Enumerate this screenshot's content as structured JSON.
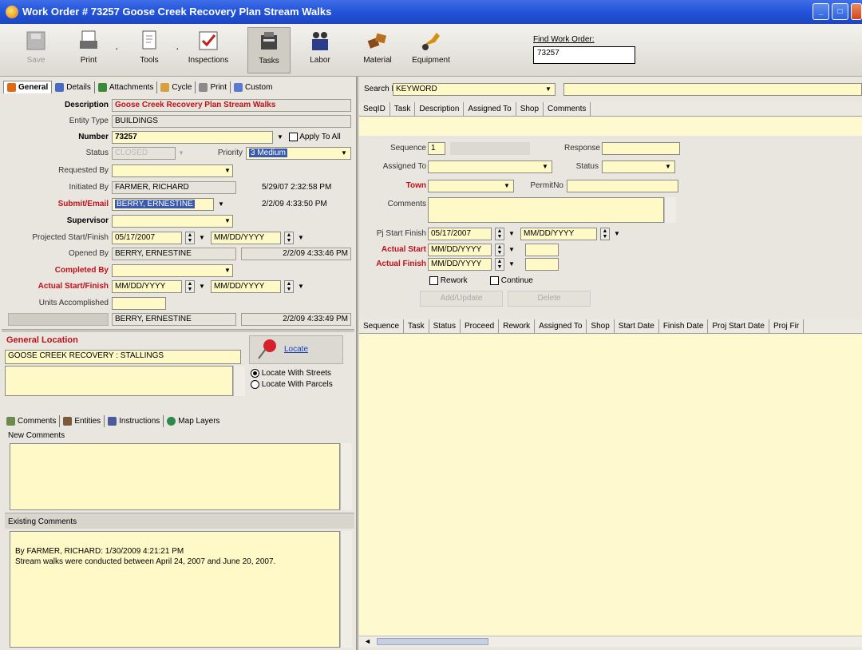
{
  "window": {
    "title": "Work Order # 73257  Goose Creek Recovery Plan Stream Walks"
  },
  "toolbar": {
    "save": "Save",
    "print": "Print",
    "tools": "Tools",
    "inspections": "Inspections",
    "tasks": "Tasks",
    "labor": "Labor",
    "material": "Material",
    "equipment": "Equipment",
    "find_label": "Find Work Order:",
    "find_value": "73257"
  },
  "left_tabs": [
    "General",
    "Details",
    "Attachments",
    "Cycle",
    "Print",
    "Custom"
  ],
  "form": {
    "description_label": "Description",
    "description": "Goose Creek Recovery Plan Stream Walks",
    "entity_type_label": "Entity Type",
    "entity_type": "BUILDINGS",
    "number_label": "Number",
    "number": "73257",
    "apply_to_all": "Apply To All",
    "status_label": "Status",
    "status": "CLOSED",
    "priority_label": "Priority",
    "priority": "3 Medium",
    "requested_by_label": "Requested By",
    "requested_by": "",
    "initiated_by_label": "Initiated By",
    "initiated_by": "FARMER, RICHARD",
    "initiated_date": "5/29/07 2:32:58 PM",
    "submit_email_label": "Submit/Email",
    "submit_email": "BERRY, ERNESTINE",
    "submit_date": "2/2/09 4:33:50 PM",
    "supervisor_label": "Supervisor",
    "supervisor": "",
    "projected_label": "Projected Start/Finish",
    "projected_start": "05/17/2007",
    "projected_finish": "MM/DD/YYYY",
    "opened_by_label": "Opened By",
    "opened_by": "BERRY, ERNESTINE",
    "opened_date": "2/2/09 4:33:46 PM",
    "completed_by_label": "Completed By",
    "completed_by": "",
    "actual_label": "Actual Start/Finish",
    "actual_start": "MM/DD/YYYY",
    "actual_finish": "MM/DD/YYYY",
    "units_label": "Units Accomplished",
    "units": "",
    "closed_by": "BERRY, ERNESTINE",
    "closed_date": "2/2/09 4:33:49 PM"
  },
  "location": {
    "label": "General Location",
    "value": "GOOSE CREEK RECOVERY : STALLINGS",
    "locate": "Locate",
    "streets": "Locate With Streets",
    "parcels": "Locate With Parcels"
  },
  "bottom_tabs": [
    "Comments",
    "Entities",
    "Instructions",
    "Map Layers"
  ],
  "comments": {
    "new_label": "New Comments",
    "existing_label": "Existing Comments",
    "existing_line1": "By FARMER, RICHARD: 1/30/2009 4:21:21 PM",
    "existing_line2": "Stream walks were conducted between April 24, 2007 and June 20, 2007."
  },
  "search": {
    "label": "Search By",
    "value": "KEYWORD"
  },
  "task_grid_cols": [
    "SeqID",
    "Task",
    "Description",
    "Assigned To",
    "Shop",
    "Comments"
  ],
  "task_form": {
    "sequence_label": "Sequence",
    "sequence": "1",
    "response_label": "Response",
    "assigned_label": "Assigned To",
    "status_label": "Status",
    "town_label": "Town",
    "permit_label": "PermitNo",
    "comments_label": "Comments",
    "pj_label": "Pj Start Finish",
    "pj_start": "05/17/2007",
    "pj_finish": "MM/DD/YYYY",
    "actual_start_label": "Actual Start",
    "actual_start": "MM/DD/YYYY",
    "actual_finish_label": "Actual Finish",
    "actual_finish": "MM/DD/YYYY",
    "rework": "Rework",
    "continue": "Continue",
    "btn1": "Add/Update",
    "btn2": "Delete"
  },
  "result_grid_cols": [
    "Sequence",
    "Task",
    "Status",
    "Proceed",
    "Rework",
    "Assigned To",
    "Shop",
    "Start Date",
    "Finish Date",
    "Proj Start Date",
    "Proj Fir"
  ]
}
